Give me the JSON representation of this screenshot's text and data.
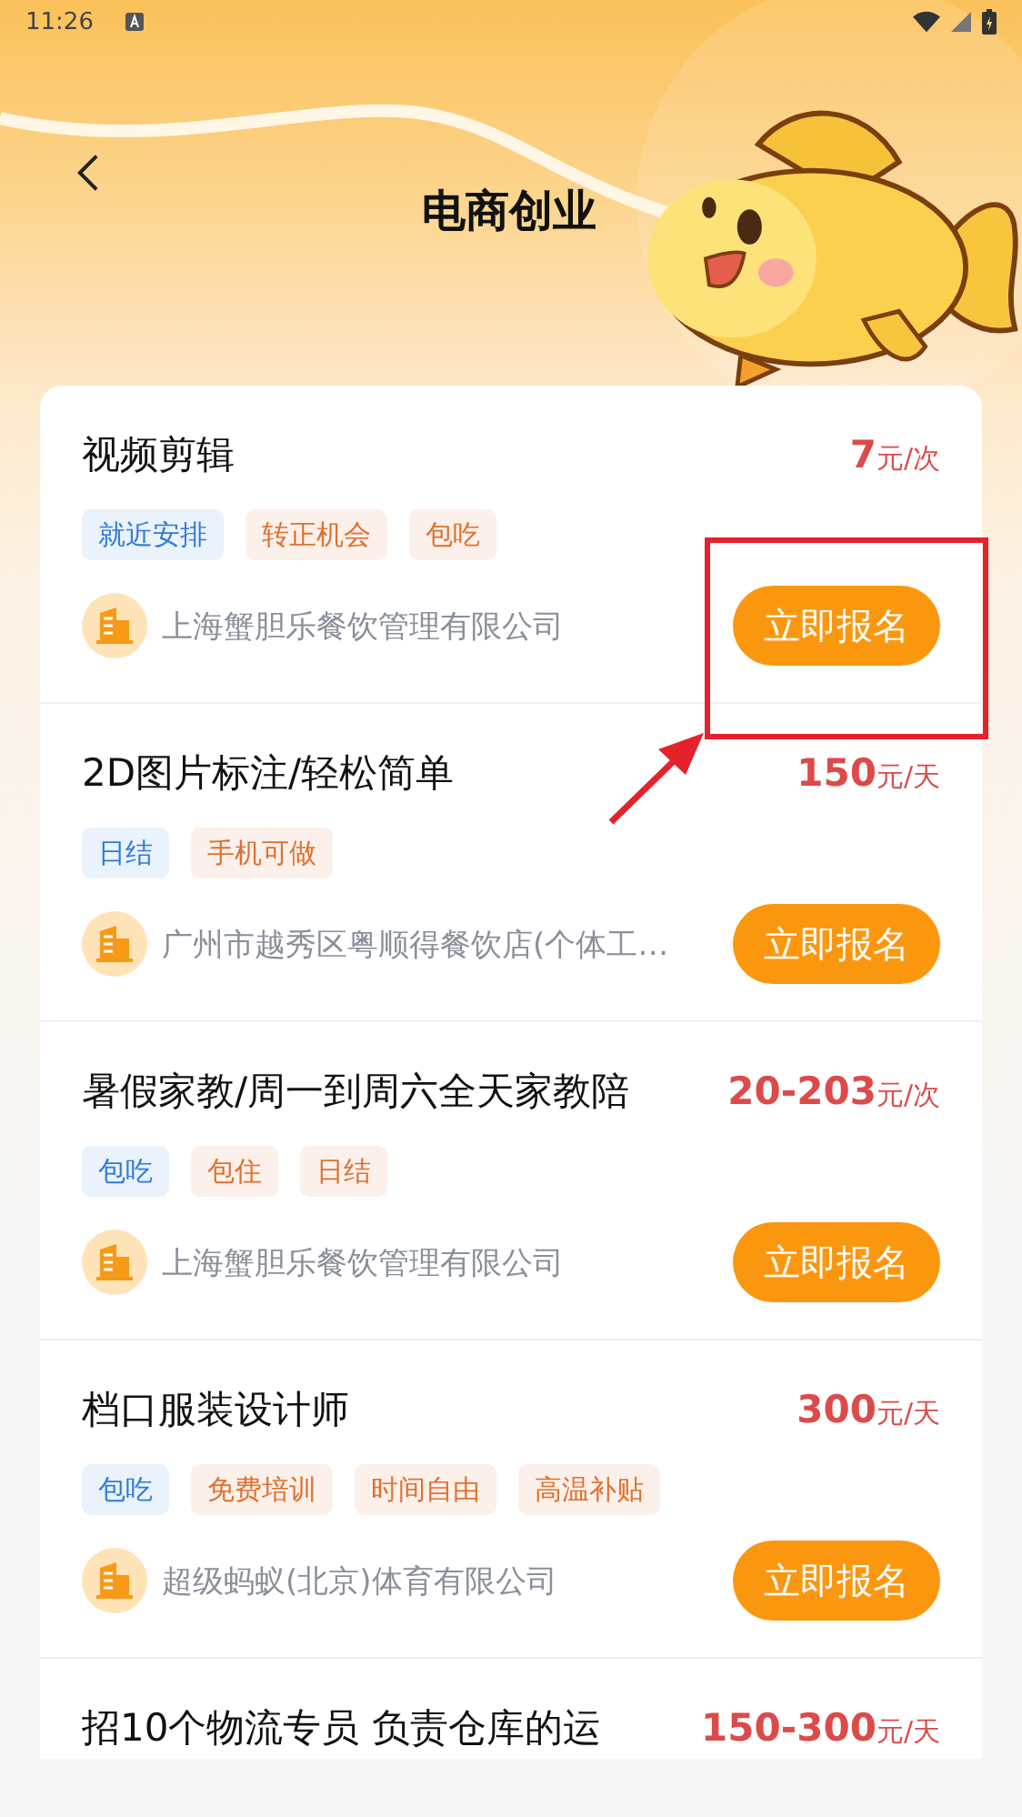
{
  "status_bar": {
    "time": "11:26"
  },
  "header": {
    "title": "电商创业"
  },
  "jobs": [
    {
      "title": "视频剪辑",
      "price": {
        "amount": "7",
        "unit": "元/次"
      },
      "tags": [
        {
          "label": "就近安排",
          "color": "#2f7bd8"
        },
        {
          "label": "转正机会",
          "color": "#e0702e"
        },
        {
          "label": "包吃",
          "color": "#e0702e"
        }
      ],
      "company": "上海蟹胆乐餐饮管理有限公司",
      "button": "立即报名"
    },
    {
      "title": "2D图片标注/轻松简单",
      "price": {
        "amount": "150",
        "unit": "元/天"
      },
      "tags": [
        {
          "label": "日结",
          "color": "#2f7bd8"
        },
        {
          "label": "手机可做",
          "color": "#e0702e"
        }
      ],
      "company": "广州市越秀区粤顺得餐饮店(个体工…",
      "button": "立即报名"
    },
    {
      "title": "暑假家教/周一到周六全天家教陪",
      "price": {
        "amount": "20-203",
        "unit": "元/次"
      },
      "tags": [
        {
          "label": "包吃",
          "color": "#2f7bd8"
        },
        {
          "label": "包住",
          "color": "#e0702e"
        },
        {
          "label": "日结",
          "color": "#e0702e"
        }
      ],
      "company": "上海蟹胆乐餐饮管理有限公司",
      "button": "立即报名"
    },
    {
      "title": "档口服装设计师",
      "price": {
        "amount": "300",
        "unit": "元/天"
      },
      "tags": [
        {
          "label": "包吃",
          "color": "#2f7bd8"
        },
        {
          "label": "免费培训",
          "color": "#e0702e"
        },
        {
          "label": "时间自由",
          "color": "#e0702e"
        },
        {
          "label": "高温补贴",
          "color": "#e0702e"
        }
      ],
      "company": "超级蚂蚁(北京)体育有限公司",
      "button": "立即报名"
    },
    {
      "title": "招10个物流专员 负责仓库的运",
      "price": {
        "amount": "150-300",
        "unit": "元/天"
      }
    }
  ]
}
